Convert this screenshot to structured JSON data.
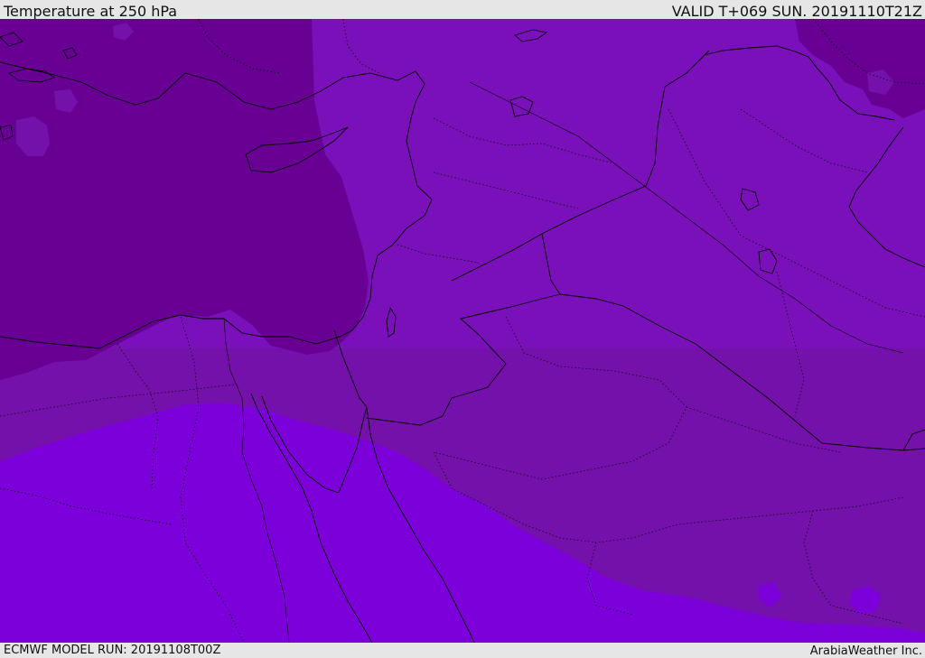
{
  "header": {
    "title": "Temperature at 250 hPa",
    "valid_time": "VALID T+069 SUN. 20191110T21Z"
  },
  "footer": {
    "model_run": "ECMWF MODEL RUN: 20191108T00Z",
    "credit": "ArabiaWeather Inc."
  },
  "map": {
    "colors": {
      "coldest": "#670093",
      "cold": "#7511ab",
      "cool": "#7b10b9",
      "warm": "#7c00d9",
      "coastline": "#000000"
    }
  }
}
